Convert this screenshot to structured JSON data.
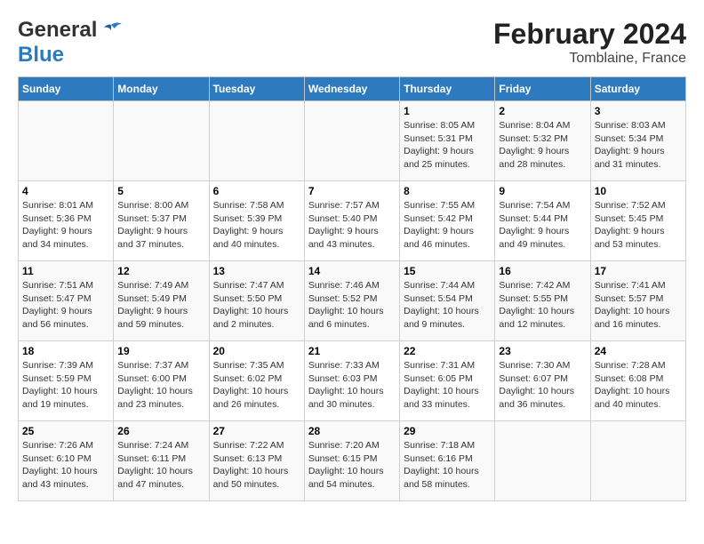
{
  "header": {
    "logo_line1": "General",
    "logo_line2": "Blue",
    "title": "February 2024",
    "subtitle": "Tomblaine, France"
  },
  "columns": [
    "Sunday",
    "Monday",
    "Tuesday",
    "Wednesday",
    "Thursday",
    "Friday",
    "Saturday"
  ],
  "weeks": [
    [
      {
        "day": "",
        "content": ""
      },
      {
        "day": "",
        "content": ""
      },
      {
        "day": "",
        "content": ""
      },
      {
        "day": "",
        "content": ""
      },
      {
        "day": "1",
        "content": "Sunrise: 8:05 AM\nSunset: 5:31 PM\nDaylight: 9 hours\nand 25 minutes."
      },
      {
        "day": "2",
        "content": "Sunrise: 8:04 AM\nSunset: 5:32 PM\nDaylight: 9 hours\nand 28 minutes."
      },
      {
        "day": "3",
        "content": "Sunrise: 8:03 AM\nSunset: 5:34 PM\nDaylight: 9 hours\nand 31 minutes."
      }
    ],
    [
      {
        "day": "4",
        "content": "Sunrise: 8:01 AM\nSunset: 5:36 PM\nDaylight: 9 hours\nand 34 minutes."
      },
      {
        "day": "5",
        "content": "Sunrise: 8:00 AM\nSunset: 5:37 PM\nDaylight: 9 hours\nand 37 minutes."
      },
      {
        "day": "6",
        "content": "Sunrise: 7:58 AM\nSunset: 5:39 PM\nDaylight: 9 hours\nand 40 minutes."
      },
      {
        "day": "7",
        "content": "Sunrise: 7:57 AM\nSunset: 5:40 PM\nDaylight: 9 hours\nand 43 minutes."
      },
      {
        "day": "8",
        "content": "Sunrise: 7:55 AM\nSunset: 5:42 PM\nDaylight: 9 hours\nand 46 minutes."
      },
      {
        "day": "9",
        "content": "Sunrise: 7:54 AM\nSunset: 5:44 PM\nDaylight: 9 hours\nand 49 minutes."
      },
      {
        "day": "10",
        "content": "Sunrise: 7:52 AM\nSunset: 5:45 PM\nDaylight: 9 hours\nand 53 minutes."
      }
    ],
    [
      {
        "day": "11",
        "content": "Sunrise: 7:51 AM\nSunset: 5:47 PM\nDaylight: 9 hours\nand 56 minutes."
      },
      {
        "day": "12",
        "content": "Sunrise: 7:49 AM\nSunset: 5:49 PM\nDaylight: 9 hours\nand 59 minutes."
      },
      {
        "day": "13",
        "content": "Sunrise: 7:47 AM\nSunset: 5:50 PM\nDaylight: 10 hours\nand 2 minutes."
      },
      {
        "day": "14",
        "content": "Sunrise: 7:46 AM\nSunset: 5:52 PM\nDaylight: 10 hours\nand 6 minutes."
      },
      {
        "day": "15",
        "content": "Sunrise: 7:44 AM\nSunset: 5:54 PM\nDaylight: 10 hours\nand 9 minutes."
      },
      {
        "day": "16",
        "content": "Sunrise: 7:42 AM\nSunset: 5:55 PM\nDaylight: 10 hours\nand 12 minutes."
      },
      {
        "day": "17",
        "content": "Sunrise: 7:41 AM\nSunset: 5:57 PM\nDaylight: 10 hours\nand 16 minutes."
      }
    ],
    [
      {
        "day": "18",
        "content": "Sunrise: 7:39 AM\nSunset: 5:59 PM\nDaylight: 10 hours\nand 19 minutes."
      },
      {
        "day": "19",
        "content": "Sunrise: 7:37 AM\nSunset: 6:00 PM\nDaylight: 10 hours\nand 23 minutes."
      },
      {
        "day": "20",
        "content": "Sunrise: 7:35 AM\nSunset: 6:02 PM\nDaylight: 10 hours\nand 26 minutes."
      },
      {
        "day": "21",
        "content": "Sunrise: 7:33 AM\nSunset: 6:03 PM\nDaylight: 10 hours\nand 30 minutes."
      },
      {
        "day": "22",
        "content": "Sunrise: 7:31 AM\nSunset: 6:05 PM\nDaylight: 10 hours\nand 33 minutes."
      },
      {
        "day": "23",
        "content": "Sunrise: 7:30 AM\nSunset: 6:07 PM\nDaylight: 10 hours\nand 36 minutes."
      },
      {
        "day": "24",
        "content": "Sunrise: 7:28 AM\nSunset: 6:08 PM\nDaylight: 10 hours\nand 40 minutes."
      }
    ],
    [
      {
        "day": "25",
        "content": "Sunrise: 7:26 AM\nSunset: 6:10 PM\nDaylight: 10 hours\nand 43 minutes."
      },
      {
        "day": "26",
        "content": "Sunrise: 7:24 AM\nSunset: 6:11 PM\nDaylight: 10 hours\nand 47 minutes."
      },
      {
        "day": "27",
        "content": "Sunrise: 7:22 AM\nSunset: 6:13 PM\nDaylight: 10 hours\nand 50 minutes."
      },
      {
        "day": "28",
        "content": "Sunrise: 7:20 AM\nSunset: 6:15 PM\nDaylight: 10 hours\nand 54 minutes."
      },
      {
        "day": "29",
        "content": "Sunrise: 7:18 AM\nSunset: 6:16 PM\nDaylight: 10 hours\nand 58 minutes."
      },
      {
        "day": "",
        "content": ""
      },
      {
        "day": "",
        "content": ""
      }
    ]
  ]
}
